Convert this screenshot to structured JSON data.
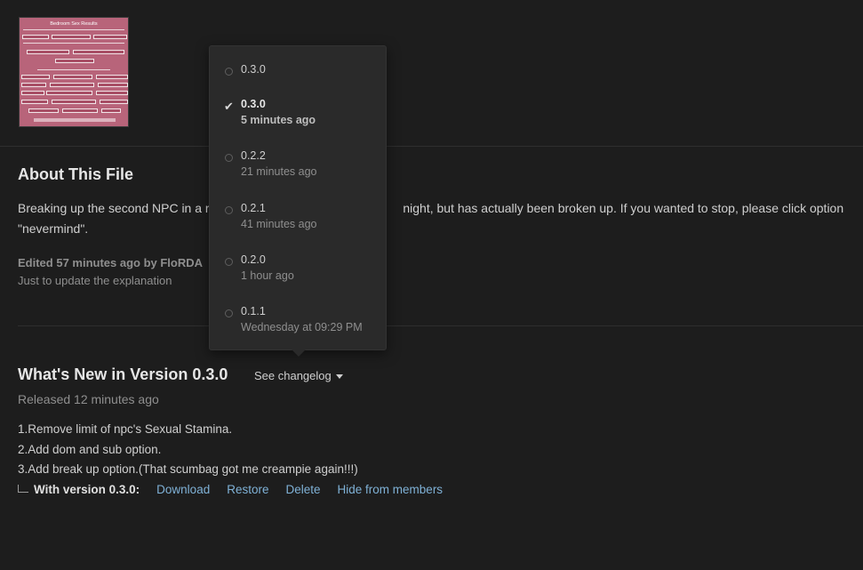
{
  "thumbnail": {
    "title": "Bedroom Sex Results",
    "alt": "mod screenshot thumbnail"
  },
  "about": {
    "title": "About This File",
    "description": "Breaking up the second NPC in a relationship. Just to update the explanation night, but has actually been broken up. If you wanted to stop, please click option \"nevermind\".",
    "description_visible_left": "Breaking up the second NPC in a ro",
    "description_visible_right": "night, but has actually been broken up. If you wanted to stop, please click option",
    "description_line2": "\"nevermind\".",
    "edited": "Edited 57 minutes ago by FloRDA",
    "edit_note": "Just to update the explanation"
  },
  "whats_new": {
    "title": "What's New in Version 0.3.0",
    "changelog_label": "See changelog",
    "released": "Released 12 minutes ago",
    "changes": [
      "1.Remove limit of npc's Sexual Stamina.",
      "2.Add dom and sub option.",
      "3.Add break up option.(That scumbag got me creampie again!!!)"
    ],
    "with_version_label": "With version 0.3.0:",
    "actions": [
      "Download",
      "Restore",
      "Delete",
      "Hide from members"
    ]
  },
  "versions_dropdown": {
    "items": [
      {
        "version": "0.3.0",
        "when": "",
        "selected": false
      },
      {
        "version": "0.3.0",
        "when": "5 minutes ago",
        "selected": true
      },
      {
        "version": "0.2.2",
        "when": "21 minutes ago",
        "selected": false
      },
      {
        "version": "0.2.1",
        "when": "41 minutes ago",
        "selected": false
      },
      {
        "version": "0.2.0",
        "when": "1 hour ago",
        "selected": false
      },
      {
        "version": "0.1.1",
        "when": "Wednesday at 09:29 PM",
        "selected": false
      }
    ]
  },
  "colors": {
    "background": "#1d1d1d",
    "link": "#7fb1d6",
    "thumbnail": "#b8647a"
  }
}
